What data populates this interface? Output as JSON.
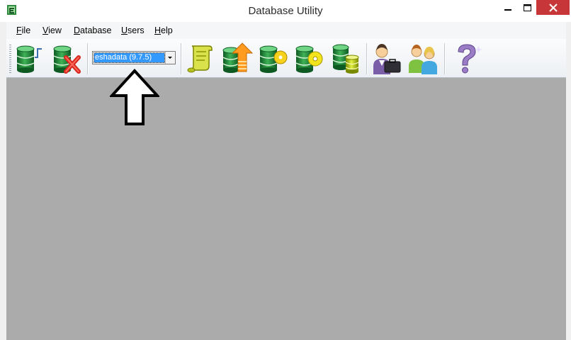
{
  "window": {
    "title": "Database Utility"
  },
  "menu": {
    "items": [
      "File",
      "View",
      "Database",
      "Users",
      "Help"
    ]
  },
  "toolbar": {
    "database_select": {
      "value": "eshadata (9.7.5)"
    },
    "buttons": [
      {
        "name": "connect-database",
        "icon": "database-connect-icon"
      },
      {
        "name": "disconnect-database",
        "icon": "database-delete-icon"
      },
      {
        "name": "view-log",
        "icon": "scroll-icon"
      },
      {
        "name": "upgrade-database",
        "icon": "database-upgrade-icon"
      },
      {
        "name": "backup-database",
        "icon": "database-backup-icon"
      },
      {
        "name": "restore-database",
        "icon": "database-restore-icon"
      },
      {
        "name": "database-files",
        "icon": "database-stack-icon"
      },
      {
        "name": "user-sessions",
        "icon": "user-briefcase-icon"
      },
      {
        "name": "manage-users",
        "icon": "users-icon"
      },
      {
        "name": "help",
        "icon": "question-mark-icon"
      }
    ]
  },
  "colors": {
    "workspace": "#ababab",
    "close": "#c7373a",
    "selection": "#3399ff"
  }
}
